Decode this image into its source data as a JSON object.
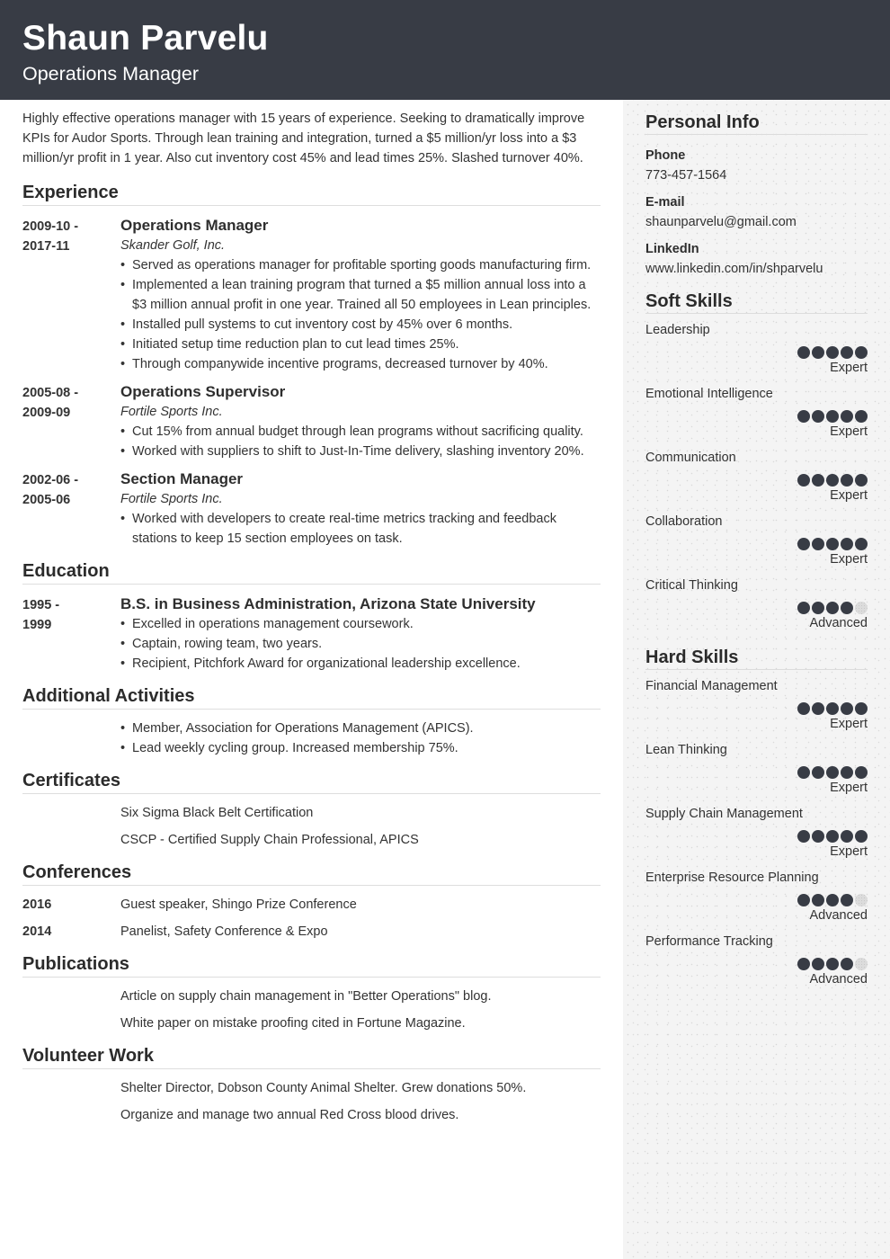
{
  "header": {
    "name": "Shaun Parvelu",
    "title": "Operations Manager"
  },
  "colors": {
    "header_bg": "#383c45",
    "sidebar_bg": "#f4f4f4",
    "dot_filled": "#383c45",
    "dot_empty": "#dcdcdc"
  },
  "summary": "Highly effective operations manager with 15 years of experience. Seeking to dramatically improve KPIs for Audor Sports. Through lean training and integration, turned a $5 million/yr loss into a $3 million/yr profit in 1 year. Also cut inventory cost 45% and lead times 25%. Slashed turnover 40%.",
  "experience": {
    "title": "Experience",
    "entries": [
      {
        "date_start": "2009-10 -",
        "date_end": "2017-11",
        "role": "Operations Manager",
        "company": "Skander Golf, Inc.",
        "bullets": [
          "Served as operations manager for profitable sporting goods manufacturing firm.",
          "Implemented a lean training program that turned a $5 million annual loss into a $3 million annual profit in one year. Trained all 50 employees in Lean principles.",
          "Installed pull systems to cut inventory cost by 45% over 6 months.",
          "Initiated setup time reduction plan to cut lead times 25%.",
          "Through companywide incentive programs, decreased turnover by 40%."
        ]
      },
      {
        "date_start": "2005-08 -",
        "date_end": "2009-09",
        "role": "Operations Supervisor",
        "company": "Fortile Sports Inc.",
        "bullets": [
          "Cut 15% from annual budget through lean programs without sacrificing quality.",
          "Worked with suppliers to shift to Just-In-Time delivery, slashing inventory 20%."
        ]
      },
      {
        "date_start": "2002-06 -",
        "date_end": "2005-06",
        "role": "Section Manager",
        "company": "Fortile Sports Inc.",
        "bullets": [
          "Worked with developers to create real-time metrics tracking and feedback stations to keep 15 section employees on task."
        ]
      }
    ]
  },
  "education": {
    "title": "Education",
    "entries": [
      {
        "date_start": "1995 -",
        "date_end": "1999",
        "degree": "B.S. in Business Administration, Arizona State University",
        "bullets": [
          "Excelled in operations management coursework.",
          "Captain, rowing team, two years.",
          "Recipient, Pitchfork Award for organizational leadership excellence."
        ]
      }
    ]
  },
  "activities": {
    "title": "Additional Activities",
    "bullets": [
      "Member, Association for Operations Management (APICS).",
      "Lead weekly cycling group. Increased membership 75%."
    ]
  },
  "certificates": {
    "title": "Certificates",
    "items": [
      "Six Sigma Black Belt Certification",
      "CSCP - Certified Supply Chain Professional, APICS"
    ]
  },
  "conferences": {
    "title": "Conferences",
    "items": [
      {
        "year": "2016",
        "text": "Guest speaker, Shingo Prize Conference"
      },
      {
        "year": "2014",
        "text": "Panelist, Safety Conference & Expo"
      }
    ]
  },
  "publications": {
    "title": "Publications",
    "items": [
      "Article on supply chain management in \"Better Operations\" blog.",
      "White paper on mistake proofing cited in Fortune Magazine."
    ]
  },
  "volunteer": {
    "title": "Volunteer Work",
    "items": [
      "Shelter Director, Dobson County Animal Shelter. Grew donations 50%.",
      "Organize and manage two annual Red Cross blood drives."
    ]
  },
  "personal_info": {
    "title": "Personal Info",
    "phone_label": "Phone",
    "phone": "773-457-1564",
    "email_label": "E-mail",
    "email": "shaunparvelu@gmail.com",
    "linkedin_label": "LinkedIn",
    "linkedin": "www.linkedin.com/in/shparvelu"
  },
  "soft_skills": {
    "title": "Soft Skills",
    "items": [
      {
        "name": "Leadership",
        "rating": 5,
        "max": 5,
        "level": "Expert"
      },
      {
        "name": "Emotional Intelligence",
        "rating": 5,
        "max": 5,
        "level": "Expert"
      },
      {
        "name": "Communication",
        "rating": 5,
        "max": 5,
        "level": "Expert"
      },
      {
        "name": "Collaboration",
        "rating": 5,
        "max": 5,
        "level": "Expert"
      },
      {
        "name": "Critical Thinking",
        "rating": 4,
        "max": 5,
        "level": "Advanced"
      }
    ]
  },
  "hard_skills": {
    "title": "Hard Skills",
    "items": [
      {
        "name": "Financial Management",
        "rating": 5,
        "max": 5,
        "level": "Expert"
      },
      {
        "name": "Lean Thinking",
        "rating": 5,
        "max": 5,
        "level": "Expert"
      },
      {
        "name": "Supply Chain Management",
        "rating": 5,
        "max": 5,
        "level": "Expert"
      },
      {
        "name": "Enterprise Resource Planning",
        "rating": 4,
        "max": 5,
        "level": "Advanced"
      },
      {
        "name": "Performance Tracking",
        "rating": 4,
        "max": 5,
        "level": "Advanced"
      }
    ]
  }
}
